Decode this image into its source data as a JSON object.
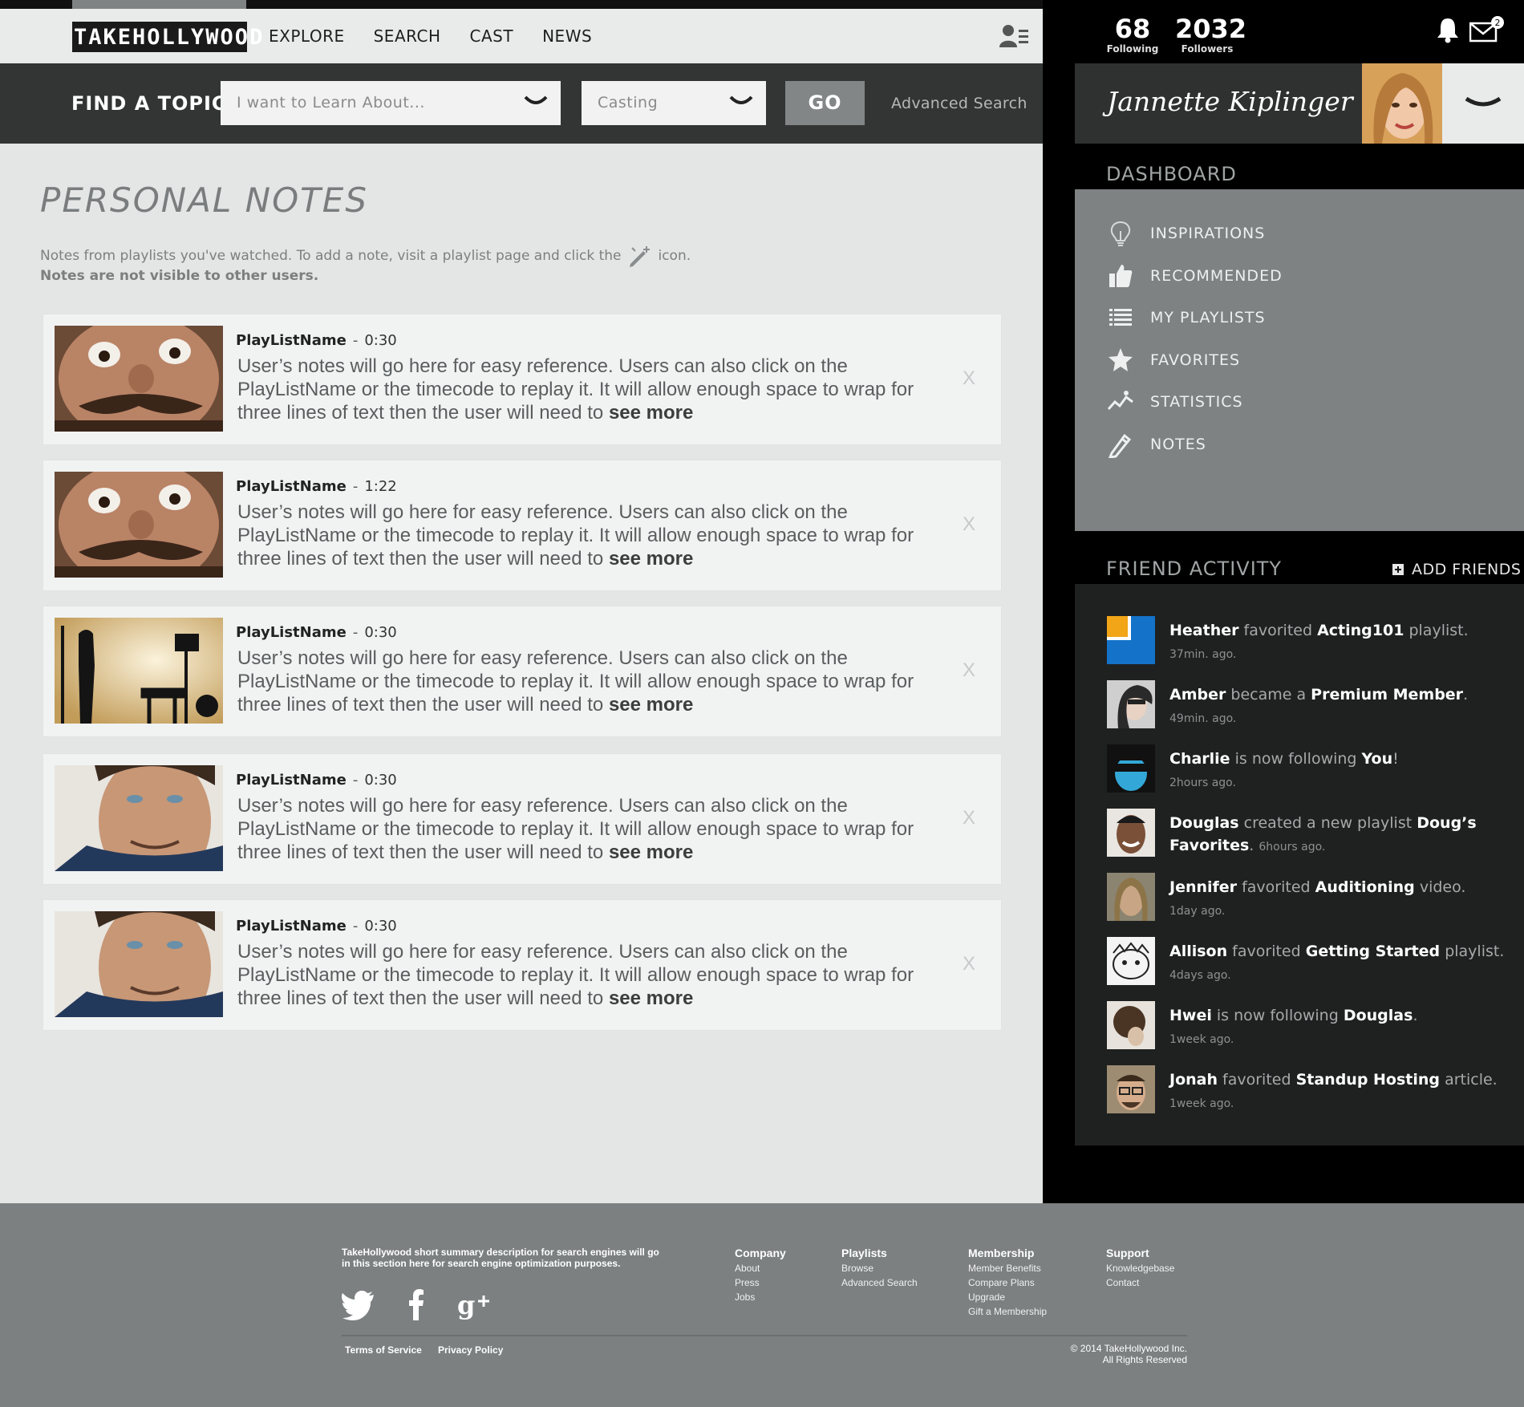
{
  "header": {
    "logo": "TAKEHOLLYWOOD",
    "nav": [
      "EXPLORE",
      "SEARCH",
      "CAST",
      "NEWS"
    ]
  },
  "findbar": {
    "label": "FIND A TOPIC",
    "topic_select": "I want to Learn About...",
    "category_select": "Casting",
    "go": "GO",
    "advanced": "Advanced Search"
  },
  "main": {
    "title": "PERSONAL NOTES",
    "intro_pre": "Notes from playlists you've watched. To add a note, visit a playlist page and click the",
    "intro_post": "icon.",
    "intro_bold": "Notes are not visible to other users.",
    "notes": [
      {
        "playlist": "PlayListName",
        "sep": "-",
        "timecode": "0:30",
        "text": "User’s notes will go here for easy reference. Users can also click on the PlayListName or the timecode to replay it. It will allow enough space to wrap for three lines of text then the user will need to",
        "more": "see more",
        "close": "X",
        "thumb": "man-wide-eyes-mustache"
      },
      {
        "playlist": "PlayListName",
        "sep": "-",
        "timecode": "1:22",
        "text": "User’s notes will go here for easy reference. Users can also click on the PlayListName or the timecode to replay it. It will allow enough space to wrap for three lines of text then the user will need to",
        "more": "see more",
        "close": "X",
        "thumb": "man-wide-eyes-mustache"
      },
      {
        "playlist": "PlayListName",
        "sep": "-",
        "timecode": "0:30",
        "text": "User’s notes will go here for easy reference. Users can also click on the PlayListName or the timecode to replay it. It will allow enough space to wrap for three lines of text then the user will need to",
        "more": "see more",
        "close": "X",
        "thumb": "film-set-silhouette"
      },
      {
        "playlist": "PlayListName",
        "sep": "-",
        "timecode": "0:30",
        "text": "User’s notes will go here for easy reference. Users can also click on the PlayListName or the timecode to replay it. It will allow enough space to wrap for three lines of text then the user will need to",
        "more": "see more",
        "close": "X",
        "thumb": "man-portrait-blue-shirt"
      },
      {
        "playlist": "PlayListName",
        "sep": "-",
        "timecode": "0:30",
        "text": "User’s notes will go here for easy reference. Users can also click on the PlayListName or the timecode to replay it. It will allow enough space to wrap for three lines of text then the user will need to",
        "more": "see more",
        "close": "X",
        "thumb": "man-portrait-blue-shirt"
      }
    ]
  },
  "sidebar": {
    "following_count": "68",
    "following_label": "Following",
    "followers_count": "2032",
    "followers_label": "Followers",
    "mail_badge": "2",
    "user_name": "Jannette Kiplinger",
    "dashboard_title": "DASHBOARD",
    "dashboard_items": [
      {
        "label": "INSPIRATIONS",
        "icon": "lightbulb-icon"
      },
      {
        "label": "RECOMMENDED",
        "icon": "thumbs-up-icon"
      },
      {
        "label": "MY PLAYLISTS",
        "icon": "list-icon"
      },
      {
        "label": "FAVORITES",
        "icon": "star-icon"
      },
      {
        "label": "STATISTICS",
        "icon": "chart-icon"
      },
      {
        "label": "NOTES",
        "icon": "pencil-icon"
      }
    ],
    "friend_activity_title": "FRIEND ACTIVITY",
    "add_friends": "ADD FRIENDS",
    "activity": [
      {
        "name": "Heather",
        "action": " favorited ",
        "target": "Acting101",
        "suffix": " playlist.",
        "time": "37min. ago."
      },
      {
        "name": "Amber",
        "action": " became a ",
        "target": "Premium Member",
        "suffix": ".",
        "time": "49min. ago."
      },
      {
        "name": "Charlie",
        "action": " is now following ",
        "target": "You",
        "suffix": "!",
        "time": "2hours ago."
      },
      {
        "name": "Douglas",
        "action": " created a new playlist ",
        "target": "Doug’s Favorites",
        "suffix": ". ",
        "time": "6hours ago."
      },
      {
        "name": "Jennifer",
        "action": " favorited ",
        "target": "Auditioning",
        "suffix": " video.",
        "time": "1day ago."
      },
      {
        "name": "Allison",
        "action": " favorited ",
        "target": "Getting Started",
        "suffix": " playlist.",
        "time": "4days ago."
      },
      {
        "name": "Hwei",
        "action": " is now following ",
        "target": "Douglas",
        "suffix": ".",
        "time": "1week ago."
      },
      {
        "name": "Jonah",
        "action": " favorited ",
        "target": "Standup Hosting",
        "suffix": " article.",
        "time": "1week ago."
      }
    ]
  },
  "footer": {
    "description": "TakeHollywood short summary description for  search engines will go in this section here for search engine optimization purposes.",
    "columns": [
      {
        "heading": "Company",
        "links": [
          "About",
          "Press",
          "Jobs"
        ]
      },
      {
        "heading": "Playlists",
        "links": [
          "Browse",
          "Advanced Search"
        ]
      },
      {
        "heading": "Membership",
        "links": [
          "Member Benefits",
          "Compare Plans",
          "Upgrade",
          "Gift a Membership"
        ]
      },
      {
        "heading": "Support",
        "links": [
          "Knowledgebase",
          "Contact"
        ]
      }
    ],
    "terms": "Terms of Service",
    "privacy": "Privacy Policy",
    "copyright_1": "© 2014 TakeHollywood Inc.",
    "copyright_2": "All Rights Reserved"
  },
  "colors": {
    "dark_bar": "#333535",
    "go_button": "#838686",
    "dashboard_panel": "#7e8282",
    "activity_panel": "#1f2121",
    "footer": "#7c8080"
  }
}
